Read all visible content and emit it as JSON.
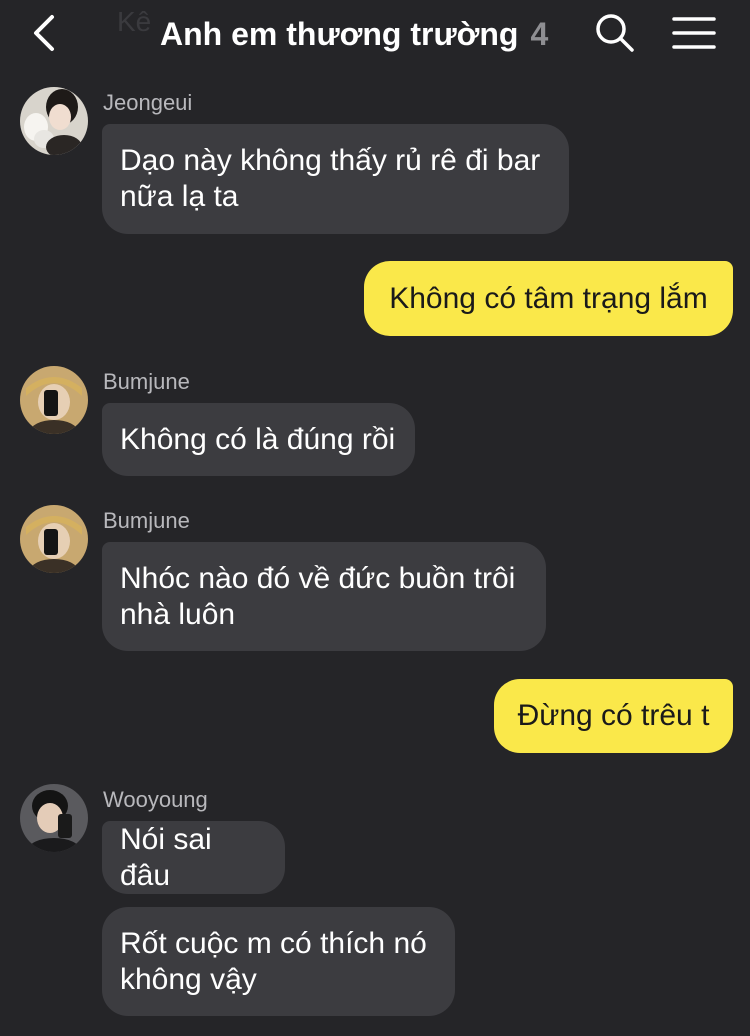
{
  "header": {
    "back_icon": "chevron-left-icon",
    "title": "Anh em thương trường",
    "member_count": "4",
    "search_icon": "search-icon",
    "menu_icon": "hamburger-menu-icon",
    "background_fragment": "Kê"
  },
  "colors": {
    "background": "#252528",
    "incoming_bubble": "#3c3c40",
    "outgoing_bubble": "#fae84a"
  },
  "messages": [
    {
      "direction": "incoming",
      "sender": "Jeongeui",
      "text": "Dạo này không thấy rủ rê đi bar nữa lạ ta"
    },
    {
      "direction": "outgoing",
      "text": "Không có tâm trạng lắm"
    },
    {
      "direction": "incoming",
      "sender": "Bumjune",
      "text": "Không có là đúng rồi"
    },
    {
      "direction": "incoming",
      "sender": "Bumjune",
      "text": "Nhóc nào đó về đức buồn trôi nhà luôn"
    },
    {
      "direction": "outgoing",
      "text": "Đừng có trêu t"
    },
    {
      "direction": "incoming",
      "sender": "Wooyoung",
      "text": "Nói sai đâu"
    },
    {
      "direction": "incoming",
      "text": "Rốt cuộc m có thích nó không vậy"
    }
  ]
}
